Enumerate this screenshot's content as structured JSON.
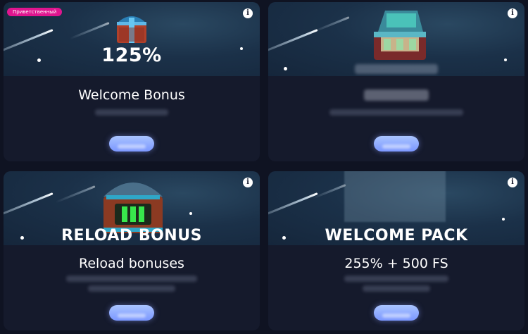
{
  "cards": [
    {
      "tag": "Приветственный",
      "banner_text": "125%",
      "title": "Welcome Bonus",
      "chest": "blue-treasure-chest"
    },
    {
      "chest": "money-suitcase"
    },
    {
      "banner_text": "RELOAD BONUS",
      "title": "Reload bonuses",
      "chest": "green-glowing-chest"
    },
    {
      "banner_text": "WELCOME PACK",
      "title": "255% + 500 FS"
    }
  ],
  "icons": {
    "info": "i"
  },
  "colors": {
    "page_bg": "#0f1322",
    "card_bg": "#151a2c",
    "tag_bg": "#e0158f",
    "button": "#8eacff"
  }
}
